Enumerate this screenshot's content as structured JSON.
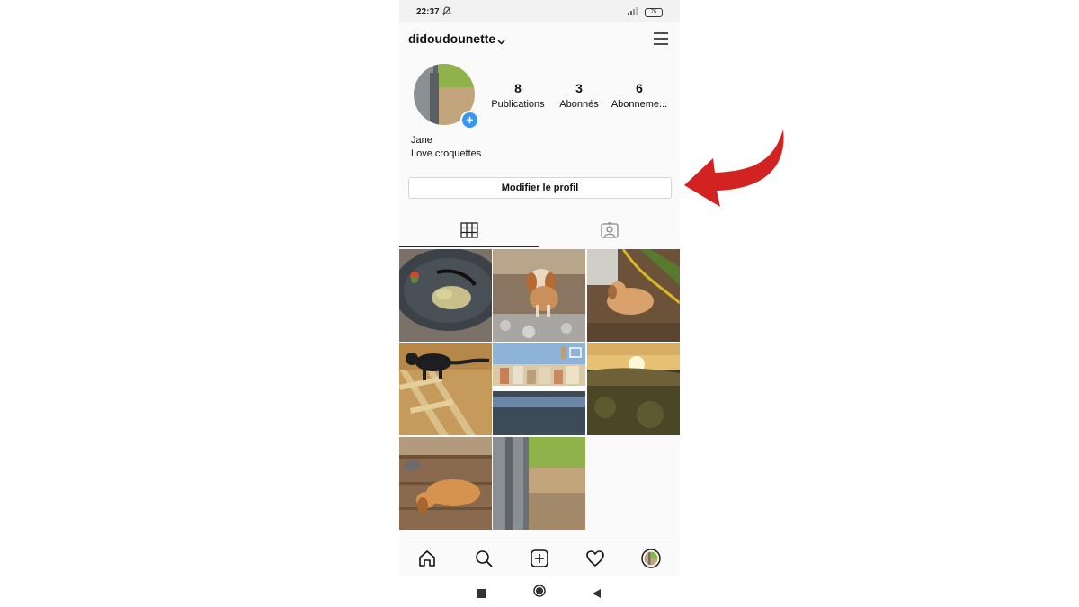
{
  "status_bar": {
    "time": "22:37",
    "battery": "75"
  },
  "header": {
    "username": "didoudounette"
  },
  "profile": {
    "stats": [
      {
        "count": "8",
        "label": "Publications"
      },
      {
        "count": "3",
        "label": "Abonnés"
      },
      {
        "count": "6",
        "label": "Abonneme..."
      }
    ],
    "name": "Jane",
    "bio": "Love croquettes",
    "edit_button": "Modifier le profil"
  },
  "tabs": [
    {
      "icon": "grid-icon",
      "active": true
    },
    {
      "icon": "tagged-photos-icon",
      "active": false
    }
  ],
  "posts": [
    {
      "subject": "plate-of-food",
      "colors": [
        "#6a6660",
        "#c7c08a"
      ]
    },
    {
      "subject": "dog-on-rocks",
      "colors": [
        "#8a7560",
        "#c9905a"
      ]
    },
    {
      "subject": "dog-lying-in-garden",
      "colors": [
        "#6b5238",
        "#d9a16c"
      ]
    },
    {
      "subject": "black-cat-on-ladder",
      "colors": [
        "#c69a5a",
        "#1e1e1e"
      ]
    },
    {
      "subject": "harbor-town",
      "colors": [
        "#8db3d8",
        "#3d4a58"
      ]
    },
    {
      "subject": "sunset-landscape",
      "colors": [
        "#f7e3a0",
        "#3d3a22"
      ]
    },
    {
      "subject": "dog-sleeping-on-deck",
      "colors": [
        "#8a6a4e",
        "#d6934f"
      ]
    },
    {
      "subject": "garden-post",
      "colors": [
        "#8fb24a",
        "#6b7075"
      ]
    }
  ],
  "bottom_nav": [
    "home-icon",
    "search-icon",
    "new-post-icon",
    "activity-heart-icon",
    "profile-avatar-icon"
  ],
  "system_nav": [
    "recents-icon",
    "home-circle-icon",
    "back-icon"
  ],
  "colors": {
    "accent_blue": "#3897f0",
    "annotation_red": "#d32222"
  }
}
